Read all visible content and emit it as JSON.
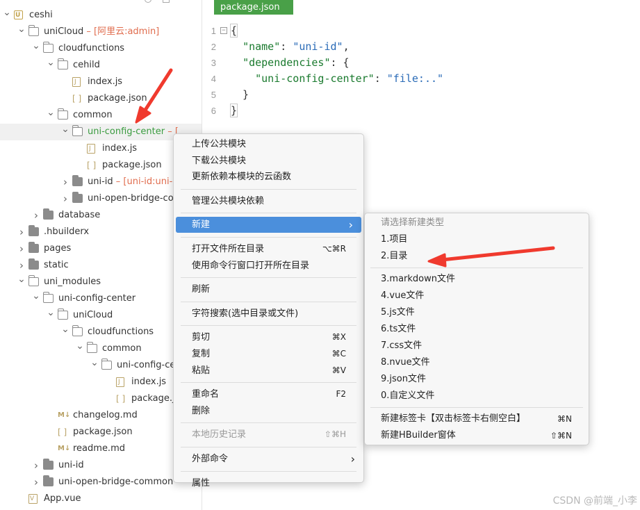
{
  "tree": [
    {
      "id": "ceshi",
      "label": "ceshi",
      "annot": "",
      "depth": 0,
      "chevron": "down",
      "icon": "root"
    },
    {
      "id": "unicloud",
      "label": "uniCloud",
      "annot": " – [阿里云:admin]",
      "depth": 1,
      "chevron": "down",
      "icon": "folder-open"
    },
    {
      "id": "cloudfunctions",
      "label": "cloudfunctions",
      "annot": "",
      "depth": 2,
      "chevron": "down",
      "icon": "folder-open"
    },
    {
      "id": "cehild",
      "label": "cehild",
      "annot": "",
      "depth": 3,
      "chevron": "down",
      "icon": "folder-open"
    },
    {
      "id": "cehild-index-js",
      "label": "index.js",
      "annot": "",
      "depth": 4,
      "chevron": "",
      "icon": "js"
    },
    {
      "id": "cehild-package-json",
      "label": "package.json",
      "annot": "",
      "depth": 4,
      "chevron": "",
      "icon": "json"
    },
    {
      "id": "common",
      "label": "common",
      "annot": "",
      "depth": 3,
      "chevron": "down",
      "icon": "folder-open"
    },
    {
      "id": "uni-config-center",
      "label": "uni-config-center",
      "annot": " – [",
      "depth": 4,
      "chevron": "down",
      "icon": "folder-open",
      "selected": true,
      "green": true
    },
    {
      "id": "ucc-index-js",
      "label": "index.js",
      "annot": "",
      "depth": 5,
      "chevron": "",
      "icon": "js"
    },
    {
      "id": "ucc-package-json",
      "label": "package.json",
      "annot": "",
      "depth": 5,
      "chevron": "",
      "icon": "json"
    },
    {
      "id": "uni-id",
      "label": "uni-id",
      "annot": " – [uni-id:uni-",
      "depth": 4,
      "chevron": "right",
      "icon": "folder"
    },
    {
      "id": "uni-open-bridge",
      "label": "uni-open-bridge-co",
      "annot": "",
      "depth": 4,
      "chevron": "right",
      "icon": "folder"
    },
    {
      "id": "database",
      "label": "database",
      "annot": "",
      "depth": 2,
      "chevron": "right",
      "icon": "folder-closed"
    },
    {
      "id": "hbuilderx",
      "label": ".hbuilderx",
      "annot": "",
      "depth": 1,
      "chevron": "right",
      "icon": "folder-closed"
    },
    {
      "id": "pages",
      "label": "pages",
      "annot": "",
      "depth": 1,
      "chevron": "right",
      "icon": "folder-closed"
    },
    {
      "id": "static",
      "label": "static",
      "annot": "",
      "depth": 1,
      "chevron": "right",
      "icon": "folder-closed"
    },
    {
      "id": "uni-modules",
      "label": "uni_modules",
      "annot": "",
      "depth": 1,
      "chevron": "down",
      "icon": "folder-open"
    },
    {
      "id": "um-ucc",
      "label": "uni-config-center",
      "annot": "",
      "depth": 2,
      "chevron": "down",
      "icon": "folder-open"
    },
    {
      "id": "um-unicloud",
      "label": "uniCloud",
      "annot": "",
      "depth": 3,
      "chevron": "down",
      "icon": "folder-open"
    },
    {
      "id": "um-cloudfunctions",
      "label": "cloudfunctions",
      "annot": "",
      "depth": 4,
      "chevron": "down",
      "icon": "folder-open"
    },
    {
      "id": "um-common",
      "label": "common",
      "annot": "",
      "depth": 5,
      "chevron": "down",
      "icon": "folder-open"
    },
    {
      "id": "um-ucc2",
      "label": "uni-config-ce",
      "annot": "",
      "depth": 6,
      "chevron": "down",
      "icon": "folder-open"
    },
    {
      "id": "um-index-js",
      "label": "index.js",
      "annot": "",
      "depth": 7,
      "chevron": "",
      "icon": "js"
    },
    {
      "id": "um-package-json",
      "label": "package.js",
      "annot": "",
      "depth": 7,
      "chevron": "",
      "icon": "json"
    },
    {
      "id": "changelog",
      "label": "changelog.md",
      "annot": "",
      "depth": 3,
      "chevron": "",
      "icon": "md"
    },
    {
      "id": "um-pkg",
      "label": "package.json",
      "annot": "",
      "depth": 3,
      "chevron": "",
      "icon": "json"
    },
    {
      "id": "readme",
      "label": "readme.md",
      "annot": "",
      "depth": 3,
      "chevron": "",
      "icon": "md"
    },
    {
      "id": "um-uni-id",
      "label": "uni-id",
      "annot": "",
      "depth": 2,
      "chevron": "right",
      "icon": "folder-closed"
    },
    {
      "id": "um-bridge",
      "label": "uni-open-bridge-common",
      "annot": "",
      "depth": 2,
      "chevron": "right",
      "icon": "folder-closed"
    },
    {
      "id": "app-vue",
      "label": "App.vue",
      "annot": "",
      "depth": 1,
      "chevron": "",
      "icon": "vue"
    }
  ],
  "editor": {
    "tab_label": "package.json",
    "lines": [
      {
        "n": "1",
        "fold": "⊟",
        "parts": [
          {
            "t": "{",
            "c": "p",
            "box": true
          }
        ]
      },
      {
        "n": "2",
        "fold": "",
        "parts": [
          {
            "t": "  ",
            "c": "p"
          },
          {
            "t": "\"name\"",
            "c": "k"
          },
          {
            "t": ": ",
            "c": "p"
          },
          {
            "t": "\"uni-id\"",
            "c": "s"
          },
          {
            "t": ",",
            "c": "p"
          }
        ]
      },
      {
        "n": "3",
        "fold": "",
        "parts": [
          {
            "t": "  ",
            "c": "p"
          },
          {
            "t": "\"dependencies\"",
            "c": "k"
          },
          {
            "t": ": {",
            "c": "p"
          }
        ]
      },
      {
        "n": "4",
        "fold": "",
        "parts": [
          {
            "t": "    ",
            "c": "p"
          },
          {
            "t": "\"uni-config-center\"",
            "c": "k"
          },
          {
            "t": ": ",
            "c": "p"
          },
          {
            "t": "\"file:..\"",
            "c": "s"
          }
        ]
      },
      {
        "n": "5",
        "fold": "",
        "parts": [
          {
            "t": "  }",
            "c": "p"
          }
        ]
      },
      {
        "n": "6",
        "fold": "",
        "parts": [
          {
            "t": "}",
            "c": "p",
            "box": true
          }
        ]
      }
    ]
  },
  "context_menu": {
    "items": [
      {
        "type": "item",
        "label": "上传公共模块",
        "shortcut": ""
      },
      {
        "type": "item",
        "label": "下载公共模块",
        "shortcut": ""
      },
      {
        "type": "item",
        "label": "更新依赖本模块的云函数",
        "shortcut": ""
      },
      {
        "type": "sep"
      },
      {
        "type": "item",
        "label": "管理公共模块依赖",
        "shortcut": ""
      },
      {
        "type": "sep"
      },
      {
        "type": "item",
        "label": "新建",
        "shortcut": "",
        "submenu": true,
        "active": true
      },
      {
        "type": "sep"
      },
      {
        "type": "item",
        "label": "打开文件所在目录",
        "shortcut": "⌥⌘R"
      },
      {
        "type": "item",
        "label": "使用命令行窗口打开所在目录",
        "shortcut": ""
      },
      {
        "type": "sep"
      },
      {
        "type": "item",
        "label": "刷新",
        "shortcut": ""
      },
      {
        "type": "sep"
      },
      {
        "type": "item",
        "label": "字符搜索(选中目录或文件)",
        "shortcut": ""
      },
      {
        "type": "sep"
      },
      {
        "type": "item",
        "label": "剪切",
        "shortcut": "⌘X"
      },
      {
        "type": "item",
        "label": "复制",
        "shortcut": "⌘C"
      },
      {
        "type": "item",
        "label": "粘贴",
        "shortcut": "⌘V"
      },
      {
        "type": "sep"
      },
      {
        "type": "item",
        "label": "重命名",
        "shortcut": "F2"
      },
      {
        "type": "item",
        "label": "删除",
        "shortcut": ""
      },
      {
        "type": "sep"
      },
      {
        "type": "item",
        "label": "本地历史记录",
        "shortcut": "⇧⌘H",
        "disabled": true
      },
      {
        "type": "sep"
      },
      {
        "type": "item",
        "label": "外部命令",
        "shortcut": "",
        "submenu": true
      },
      {
        "type": "sep"
      },
      {
        "type": "item",
        "label": "属性",
        "shortcut": ""
      }
    ]
  },
  "sub_menu": {
    "items": [
      {
        "type": "header",
        "label": "请选择新建类型"
      },
      {
        "type": "item",
        "label": "1.项目",
        "shortcut": ""
      },
      {
        "type": "item",
        "label": "2.目录",
        "shortcut": ""
      },
      {
        "type": "sep"
      },
      {
        "type": "item",
        "label": "3.markdown文件",
        "shortcut": ""
      },
      {
        "type": "item",
        "label": "4.vue文件",
        "shortcut": ""
      },
      {
        "type": "item",
        "label": "5.js文件",
        "shortcut": ""
      },
      {
        "type": "item",
        "label": "6.ts文件",
        "shortcut": ""
      },
      {
        "type": "item",
        "label": "7.css文件",
        "shortcut": ""
      },
      {
        "type": "item",
        "label": "8.nvue文件",
        "shortcut": ""
      },
      {
        "type": "item",
        "label": "9.json文件",
        "shortcut": ""
      },
      {
        "type": "item",
        "label": "0.自定义文件",
        "shortcut": ""
      },
      {
        "type": "sep"
      },
      {
        "type": "item",
        "label": "新建标签卡【双击标签卡右侧空白】",
        "shortcut": "⌘N"
      },
      {
        "type": "item",
        "label": "新建HBuilder窗体",
        "shortcut": "⇧⌘N"
      }
    ]
  },
  "colors": {
    "annotation_arrow": "#f03a2e",
    "menu_highlight": "#4b8fdc",
    "tab_green": "#49a048"
  },
  "watermark": "CSDN @前端_小李"
}
